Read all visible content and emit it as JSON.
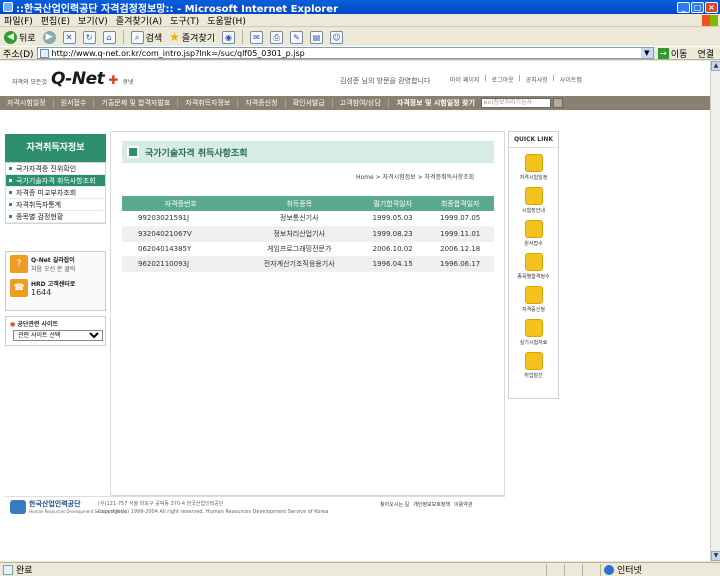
{
  "window": {
    "title": "::한국산업인력공단 자격검정정보망:: - Microsoft Internet Explorer"
  },
  "menu": [
    "파일(F)",
    "편집(E)",
    "보기(V)",
    "즐겨찾기(A)",
    "도구(T)",
    "도움말(H)"
  ],
  "toolbar": {
    "back": "뒤로",
    "search": "검색",
    "favorites": "즐겨찾기"
  },
  "address": {
    "label": "주소(D)",
    "url": "http://www.q-net.or.kr/com_intro.jsp?lnk=/suc/qlf05_0301_p.jsp",
    "go": "이동",
    "links": "연결"
  },
  "site": {
    "tagline": "자격의 모든것",
    "brand": "Q-Net",
    "brand_sub": "큐넷",
    "welcome": "김성준 님의 방문을 환영합니다",
    "top_links": [
      "마이 페이지",
      "로그아웃",
      "공지사항",
      "사이트맵"
    ]
  },
  "gnb": {
    "items": [
      "자격시험일정",
      "원서접수",
      "기출문제 및 합격자발표",
      "자격취득자정보",
      "자격증신청",
      "확인서발급",
      "고객참여/상담"
    ],
    "search_label": "자격정보 및 시험일정 찾기",
    "search_placeholder": "ex)정보처리기능사"
  },
  "lnb": {
    "title": "자격취득자정보",
    "items": [
      "국가자격증 진위확인",
      "국가기술자격 취득사항조회",
      "자격증 미교부자조회",
      "자격취득자통계",
      "종목별 검정현황"
    ],
    "active_index": 1
  },
  "sidebox": {
    "qnet_title": "Q-Net 길라잡이",
    "qnet_sub": "처음 오신 분 클릭",
    "call_title": "HRD 고객센터로",
    "call_number": "1644"
  },
  "sites": {
    "label": "공단관련 사이트",
    "select": "관련 사이트 선택"
  },
  "main": {
    "title": "국가기술자격 취득사항조회",
    "breadcrumb": "Home > 자격시험정보 > 자격증취득사항조회",
    "columns": [
      "자격증번호",
      "취득종목",
      "필기합격일자",
      "최종합격일자"
    ],
    "rows": [
      [
        "99203021591J",
        "정보통신기사",
        "1999.05.03",
        "1999.07.05"
      ],
      [
        "93204021067V",
        "정보처리산업기사",
        "1999.08.23",
        "1999.11.01"
      ],
      [
        "06204014385Y",
        "게임프로그래밍전문가",
        "2006.10.02",
        "2006.12.18"
      ],
      [
        "96202110093J",
        "전자계산기조직응용기사",
        "1996.04.15",
        "1996.06.17"
      ]
    ]
  },
  "quick": {
    "title": "QUICK LINK",
    "items": [
      "자격시험일정",
      "시험장안내",
      "원서접수",
      "종목별합격정수",
      "자격증신청",
      "실기시험자료",
      "취업알선"
    ]
  },
  "footer": {
    "org_name": "한국산업인력공단",
    "org_eng": "Human Resources Development Service of Korea",
    "address": "(우)121-757 서울 마포구 공덕동 370-4 한국산업인력공단",
    "copyright": "Copyright(c) 1999-2004 All right reserved. Human Resources Development Service of Korea",
    "links": [
      "찾아오시는 길",
      "개인정보보호정책",
      "이용약관"
    ]
  },
  "status": {
    "text": "완료",
    "zone": "인터넷"
  }
}
